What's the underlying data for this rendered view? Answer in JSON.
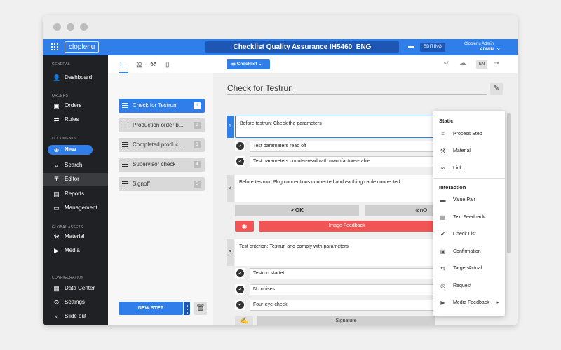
{
  "app": {
    "brand": "cloplenu",
    "doc_title": "Checklist Quality Assurance IH5460_ENG",
    "mode": "EDITING",
    "user_name": "Cloplenu Admin",
    "user_role": "ADMIN"
  },
  "sidebar": {
    "sections": {
      "general": "GENERAL",
      "orders": "ORDERS",
      "documents": "DOCUMENTS",
      "global_assets": "GLOBAL ASSETS",
      "configuration": "CONFIGURATION"
    },
    "items": {
      "dashboard": "Dashboard",
      "orders": "Orders",
      "rules": "Rules",
      "new": "New",
      "search": "Search",
      "editor": "Editor",
      "reports": "Reports",
      "management": "Management",
      "material": "Material",
      "media": "Media",
      "data_center": "Data Center",
      "settings": "Settings",
      "slide_out": "Slide out"
    }
  },
  "steps": [
    {
      "label": "Check for Testrun",
      "num": "1"
    },
    {
      "label": "Production order b...",
      "num": "2"
    },
    {
      "label": "Completed produc...",
      "num": "3"
    },
    {
      "label": "Supervisor check",
      "num": "4"
    },
    {
      "label": "Signoff",
      "num": "5"
    }
  ],
  "actions": {
    "new_step": "NEW STEP"
  },
  "toolbar": {
    "checklist": "Checklist",
    "language": "EN"
  },
  "main": {
    "title": "Check for Testrun",
    "procedures": [
      {
        "num": "1",
        "text": "Before testrun: Check the parameters"
      },
      {
        "num": "2",
        "text": "Before testrun: Plug connections connected and earthing cable connected"
      },
      {
        "num": "3",
        "text": "Test criterion: Testrun and comply with parameters"
      }
    ],
    "checks_1": [
      "Test parameters read off",
      "Test parameters counter-read with manufacturer-table"
    ],
    "checks_3": [
      "Testrun startet",
      "No noises",
      "Four-eye-check"
    ],
    "ok": "OK",
    "nok": "nO",
    "image_feedback": "Image Feedback",
    "signature": "Signature"
  },
  "menu": {
    "static_header": "Static",
    "interaction_header": "Interaction",
    "static_items": [
      "Process Step",
      "Material",
      "Link"
    ],
    "interaction_items": [
      "Value Pair",
      "Text Feedback",
      "Check List",
      "Confirmation",
      "Target-Actual",
      "Request",
      "Media Feedback"
    ]
  },
  "colors": {
    "accent": "#2f7ee9",
    "accent_dark": "#1e56b4",
    "danger": "#f05454",
    "sidebar_bg": "#1f2124"
  }
}
